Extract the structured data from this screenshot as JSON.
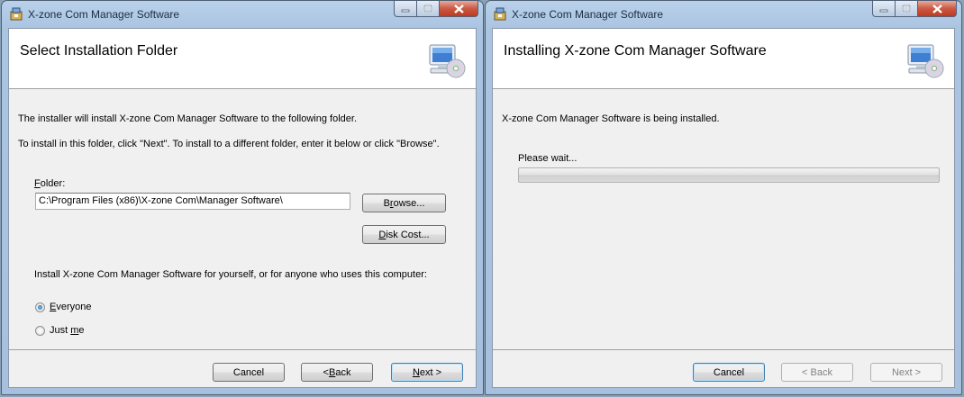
{
  "left_window": {
    "title": "X-zone Com Manager Software",
    "banner_title": "Select Installation Folder",
    "intro_text": "The installer will install X-zone Com Manager Software to the following folder.",
    "instructions_text": "To install in this folder, click \"Next\". To install to a different folder, enter it below or click \"Browse\".",
    "folder_label_accel": "F",
    "folder_label_rest": "older:",
    "folder_value": "C:\\Program Files (x86)\\X-zone Com\\Manager Software\\",
    "browse_button_pre": "B",
    "browse_button_accel": "r",
    "browse_button_rest": "owse...",
    "disk_cost_button_accel": "D",
    "disk_cost_button_rest": "isk Cost...",
    "install_for_text": "Install X-zone Com Manager Software for yourself, or for anyone who uses this computer:",
    "radio_everyone_accel": "E",
    "radio_everyone_rest": "veryone",
    "radio_justme_pre": "Just ",
    "radio_justme_accel": "m",
    "radio_justme_rest": "e",
    "selected_option": "Everyone",
    "cancel_button": "Cancel",
    "back_button_pre": "< ",
    "back_button_accel": "B",
    "back_button_rest": "ack",
    "next_button_pre": "",
    "next_button_accel": "N",
    "next_button_rest": "ext >"
  },
  "right_window": {
    "title": "X-zone Com Manager Software",
    "banner_title": "Installing X-zone Com Manager Software",
    "status_text": "X-zone Com Manager Software is being installed.",
    "please_wait": "Please wait...",
    "progress": 0,
    "cancel_button": "Cancel",
    "back_button": "< Back",
    "next_button": "Next >"
  },
  "icons": {
    "app_icon": "installer-app-icon",
    "banner_icon": "computer-cd-icon",
    "minimize": "minimize-icon",
    "maximize": "maximize-icon",
    "close": "close-icon"
  },
  "colors": {
    "accent": "#3c7fb1",
    "close_button": "#c0391e",
    "window_frame": "#aac4e2"
  }
}
